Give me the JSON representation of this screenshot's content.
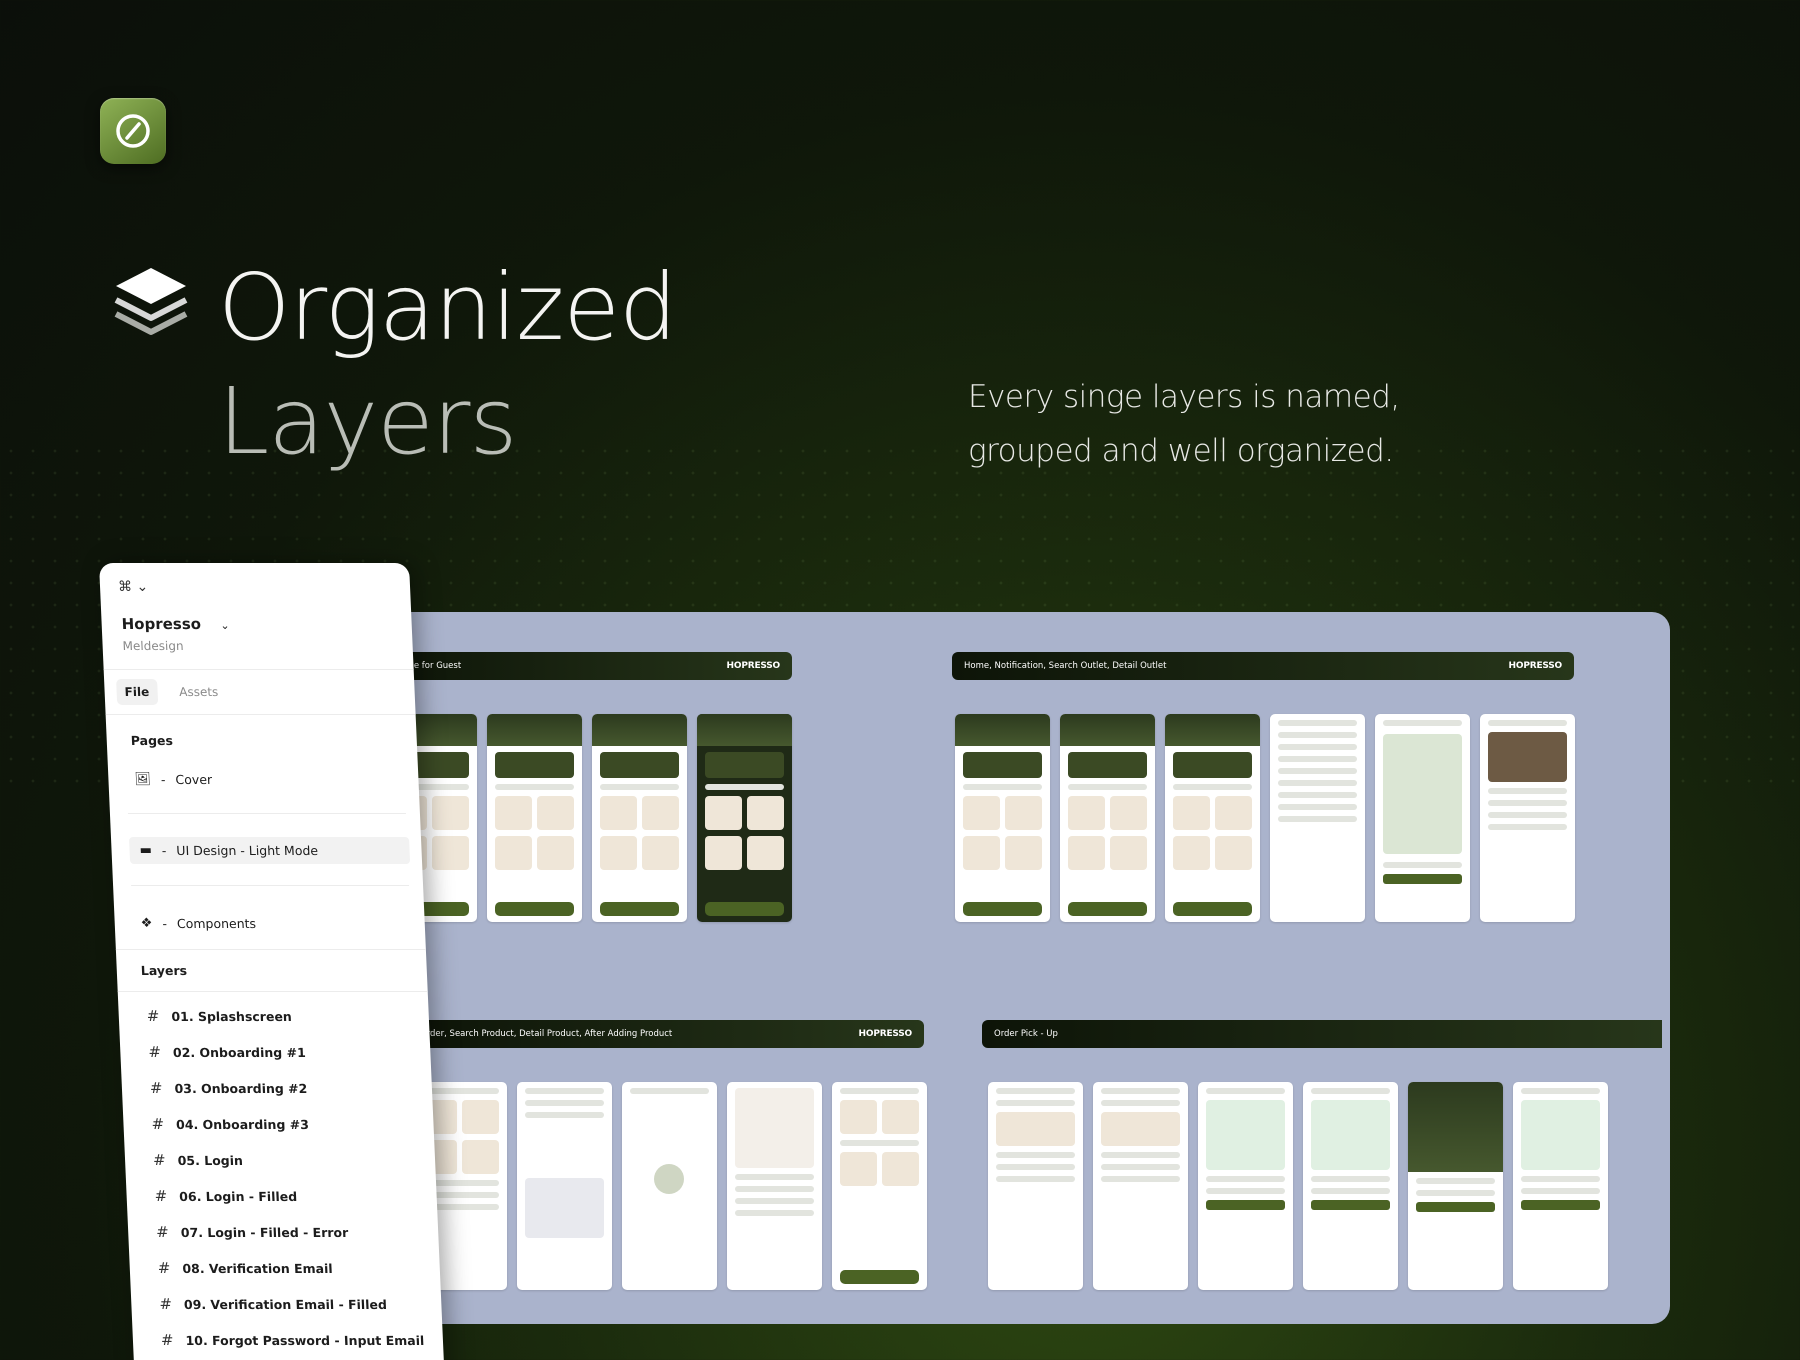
{
  "hero": {
    "title_line1": "Organized",
    "title_line2": "Layers",
    "tagline": "Every singe layers is named, grouped and well organized."
  },
  "panel": {
    "project_name": "Hopresso",
    "project_owner": "Meldesign",
    "tabs": [
      {
        "label": "File",
        "active": true
      },
      {
        "label": "Assets",
        "active": false
      }
    ],
    "pages_heading": "Pages",
    "pages": [
      {
        "label": "Cover",
        "icon": "image-icon"
      },
      {
        "label": "UI Design - Light Mode",
        "icon": "monitor-icon",
        "selected": true
      },
      {
        "label": "Components",
        "icon": "component-icon"
      }
    ],
    "page_separator": "-",
    "layers_heading": "Layers",
    "layers": [
      "01. Splashscreen",
      "02. Onboarding #1",
      "03. Onboarding #2",
      "04. Onboarding #3",
      "05. Login",
      "06. Login - Filled",
      "07. Login - Filled - Error",
      "08. Verification Email",
      "09. Verification Email - Filled",
      "10. Forgot Password -  Input Email"
    ]
  },
  "canvas": {
    "boards": [
      {
        "title": "Home for Guest",
        "logo": "HOPRESSO"
      },
      {
        "title": "Home, Notification, Search Outlet, Detail Outlet",
        "logo": "HOPRESSO"
      },
      {
        "title": "Order, Search Product, Detail Product, After Adding Product",
        "logo": "HOPRESSO"
      },
      {
        "title": "Order Pick - Up",
        "logo": ""
      }
    ]
  },
  "colors": {
    "accent": "#4b6324",
    "canvas_bg": "#aab3cc",
    "app_icon": "#7a9a40"
  }
}
